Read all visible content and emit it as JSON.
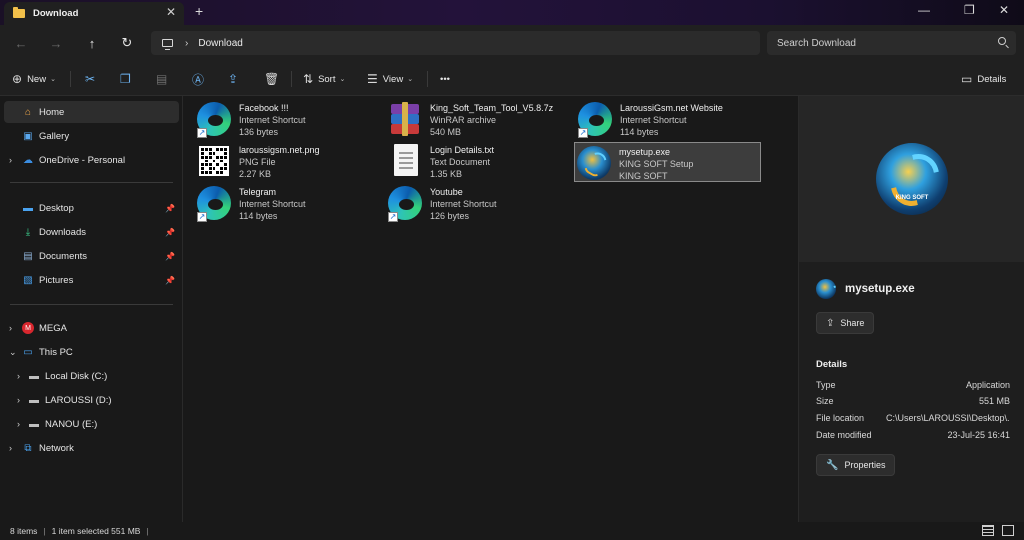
{
  "window": {
    "tab_title": "Download",
    "tab_close": "✕",
    "new_tab": "+",
    "minimize": "—",
    "maximize": "❐",
    "close": "✕"
  },
  "navigation": {
    "back": "←",
    "forward": "→",
    "up": "↑",
    "refresh": "↻",
    "breadcrumb": "Download",
    "breadcrumb_chevron": "›",
    "search_placeholder": "Search Download"
  },
  "toolbar": {
    "new_label": "New",
    "sort_label": "Sort",
    "view_label": "View",
    "more": "•••",
    "details_label": "Details",
    "caret": "⌄"
  },
  "sidebar": {
    "quick": [
      {
        "label": "Home",
        "icon": "home-icon"
      },
      {
        "label": "Gallery",
        "icon": "gallery-icon"
      },
      {
        "label": "OneDrive - Personal",
        "icon": "onedrive-icon"
      }
    ],
    "pinned": [
      {
        "label": "Desktop",
        "icon": "desktop-icon"
      },
      {
        "label": "Downloads",
        "icon": "downloads-icon"
      },
      {
        "label": "Documents",
        "icon": "documents-icon"
      },
      {
        "label": "Pictures",
        "icon": "pictures-icon"
      }
    ],
    "tree": [
      {
        "label": "MEGA",
        "icon": "mega-icon"
      },
      {
        "label": "This PC",
        "icon": "this-pc-icon"
      },
      {
        "label": "Local Disk (C:)",
        "icon": "drive-icon"
      },
      {
        "label": "LAROUSSI (D:)",
        "icon": "drive-icon"
      },
      {
        "label": "NANOU (E:)",
        "icon": "drive-icon"
      },
      {
        "label": "Network",
        "icon": "network-icon"
      }
    ]
  },
  "files": [
    {
      "name": "Facebook !!!",
      "type": "Internet Shortcut",
      "size": "136 bytes",
      "icon": "edge-icon"
    },
    {
      "name": "King_Soft_Team_Tool_V5.8.7z",
      "type": "WinRAR archive",
      "size": "540 MB",
      "icon": "winrar-icon"
    },
    {
      "name": "LaroussiGsm.net Website",
      "type": "Internet Shortcut",
      "size": "114 bytes",
      "icon": "edge-icon"
    },
    {
      "name": "laroussigsm.net.png",
      "type": "PNG File",
      "size": "2.27 KB",
      "icon": "qr-image-icon"
    },
    {
      "name": "Login Details.txt",
      "type": "Text Document",
      "size": "1.35 KB",
      "icon": "text-document-icon"
    },
    {
      "name": "mysetup.exe",
      "type": "KING SOFT Setup",
      "size": "KING SOFT",
      "icon": "king-soft-app-icon",
      "selected": true
    },
    {
      "name": "Telegram",
      "type": "Internet Shortcut",
      "size": "114 bytes",
      "icon": "edge-icon"
    },
    {
      "name": "Youtube",
      "type": "Internet Shortcut",
      "size": "126 bytes",
      "icon": "edge-icon"
    }
  ],
  "details": {
    "file_name": "mysetup.exe",
    "share_label": "Share",
    "section_title": "Details",
    "properties": [
      {
        "key": "Type",
        "value": "Application"
      },
      {
        "key": "Size",
        "value": "551 MB"
      },
      {
        "key": "File location",
        "value": "C:\\Users\\LAROUSSI\\Desktop\\..."
      },
      {
        "key": "Date modified",
        "value": "23-Jul-25 16:41"
      }
    ],
    "properties_label": "Properties"
  },
  "status": {
    "item_count": "8 items",
    "selection": "1 item selected  551 MB",
    "separator": "|"
  },
  "colors": {
    "accent": "#6db4f2",
    "folder": "#f2c04a",
    "background": "#191919"
  }
}
